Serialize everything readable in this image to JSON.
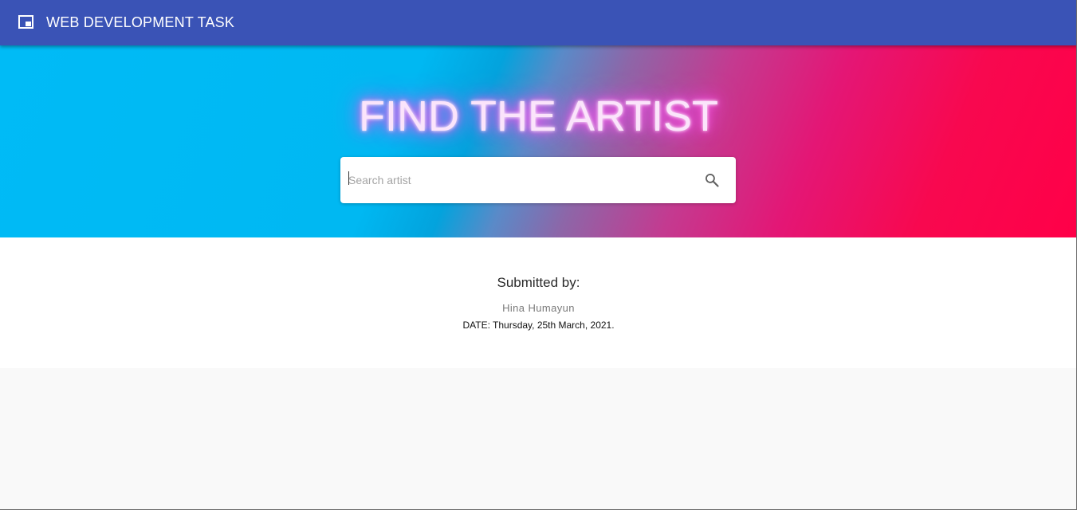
{
  "appbar": {
    "title": "WEB DEVELOPMENT TASK",
    "icon": "picture-in-picture-icon",
    "background": "#3a53b6"
  },
  "hero": {
    "title": "FIND THE ARTIST",
    "gradient_colors": [
      "#00bbf6",
      "#8d66a8",
      "#ff0048"
    ],
    "glow_color": "#ff3ce8"
  },
  "search": {
    "placeholder": "Search artist",
    "value": "",
    "icon": "search-icon"
  },
  "credits": {
    "heading": "Submitted by:",
    "name": "Hina Humayun",
    "date": "DATE: Thursday, 25th March, 2021."
  }
}
